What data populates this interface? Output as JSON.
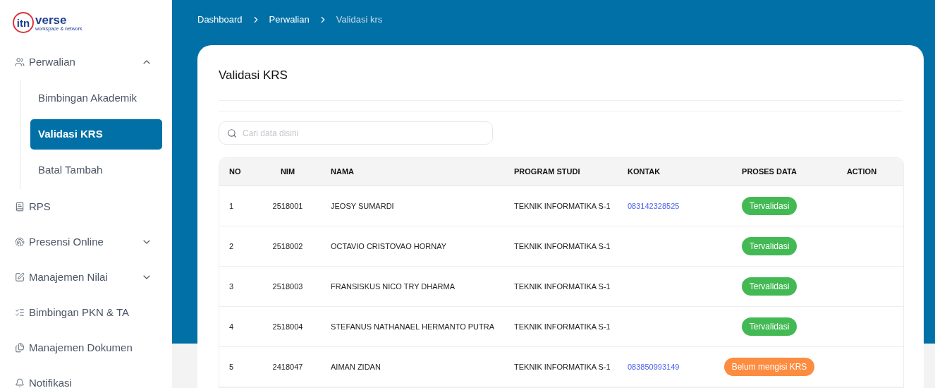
{
  "logo": {
    "mark": "itn",
    "name": "verse",
    "tagline": "workspace & network"
  },
  "sidebar": {
    "items": [
      {
        "label": "Perwalian",
        "expanded": true,
        "children": [
          {
            "label": "Bimbingan Akademik",
            "selected": false
          },
          {
            "label": "Validasi KRS",
            "selected": true
          },
          {
            "label": "Batal Tambah",
            "selected": false
          }
        ]
      },
      {
        "label": "RPS"
      },
      {
        "label": "Presensi Online",
        "expanded": false
      },
      {
        "label": "Manajemen Nilai",
        "expanded": false
      },
      {
        "label": "Bimbingan PKN & TA"
      },
      {
        "label": "Manajemen Dokumen"
      },
      {
        "label": "Notifikasi"
      }
    ]
  },
  "breadcrumb": [
    {
      "label": "Dashboard",
      "current": false
    },
    {
      "label": "Perwalian",
      "current": false
    },
    {
      "label": "Validasi krs",
      "current": true
    }
  ],
  "page_title": "Validasi KRS",
  "search": {
    "placeholder": "Cari data disini"
  },
  "table": {
    "columns": [
      "NO",
      "NIM",
      "NAMA",
      "PROGRAM STUDI",
      "KONTAK",
      "PROSES DATA",
      "ACTION"
    ],
    "rows": [
      {
        "no": "1",
        "nim": "2518001",
        "nama": "JEOSY SUMARDI",
        "program_studi": "TEKNIK INFORMATIKA S-1",
        "kontak": "083142328525",
        "status": {
          "kind": "validated",
          "label": "Tervalidasi"
        }
      },
      {
        "no": "2",
        "nim": "2518002",
        "nama": "OCTAVIO CRISTOVAO HORNAY",
        "program_studi": "TEKNIK INFORMATIKA S-1",
        "status": {
          "kind": "validated",
          "label": "Tervalidasi"
        }
      },
      {
        "no": "3",
        "nim": "2518003",
        "nama": "FRANSISKUS NICO TRY DHARMA",
        "program_studi": "TEKNIK INFORMATIKA S-1",
        "status": {
          "kind": "validated",
          "label": "Tervalidasi"
        }
      },
      {
        "no": "4",
        "nim": "2518004",
        "nama": "STEFANUS NATHANAEL HERMANTO PUTRA",
        "program_studi": "TEKNIK INFORMATIKA S-1",
        "status": {
          "kind": "validated",
          "label": "Tervalidasi"
        }
      },
      {
        "no": "5",
        "nim": "2418047",
        "nama": "AIMAN ZIDAN",
        "program_studi": "TEKNIK INFORMATIKA S-1",
        "kontak": "083850993149",
        "status": {
          "kind": "unfilled",
          "label": "Belum mengisi KRS"
        }
      }
    ]
  }
}
